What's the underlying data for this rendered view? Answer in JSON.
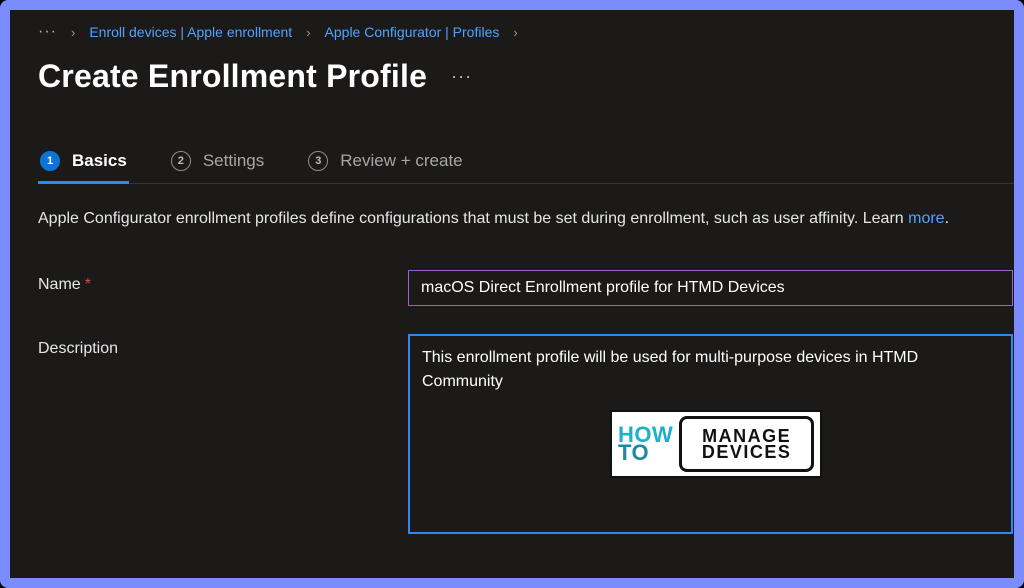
{
  "breadcrumb": {
    "ellipsis": "···",
    "items": [
      {
        "label": "Enroll devices | Apple enrollment"
      },
      {
        "label": "Apple Configurator | Profiles"
      }
    ]
  },
  "title": "Create Enrollment Profile",
  "title_more": "···",
  "steps": [
    {
      "num": "1",
      "label": "Basics",
      "active": true
    },
    {
      "num": "2",
      "label": "Settings",
      "active": false
    },
    {
      "num": "3",
      "label": "Review + create",
      "active": false
    }
  ],
  "intro": {
    "text": "Apple Configurator enrollment profiles define configurations that must be set during enrollment, such as user affinity. ",
    "link_prefix": "Learn ",
    "link": "more",
    "link_suffix": "."
  },
  "form": {
    "name_label": "Name",
    "name_required_mark": "*",
    "name_value": "macOS Direct Enrollment profile for HTMD Devices",
    "description_label": "Description",
    "description_value": "This enrollment profile will be used for multi-purpose devices in HTMD Community"
  },
  "watermark": {
    "how": "HOW",
    "to": "TO",
    "line1": "MANAGE",
    "line2": "DEVICES"
  }
}
